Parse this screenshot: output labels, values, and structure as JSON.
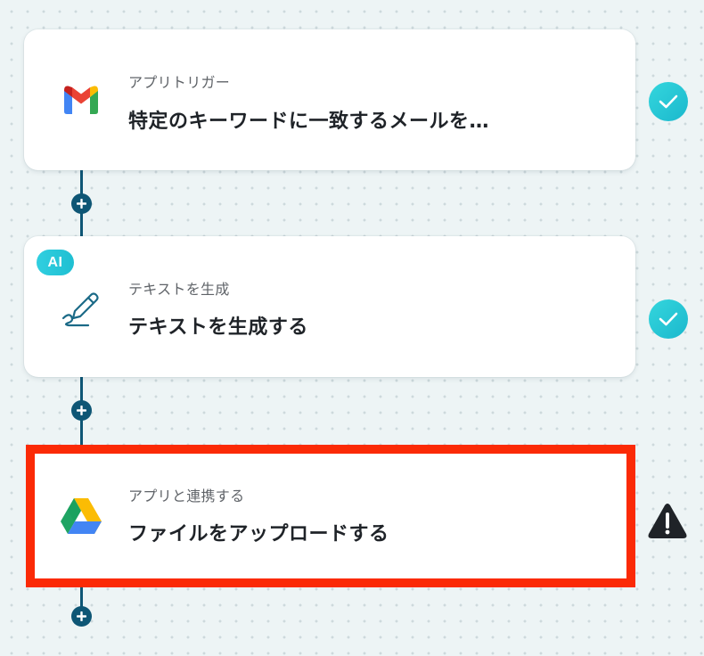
{
  "steps": [
    {
      "subtitle": "アプリトリガー",
      "title": "特定のキーワードに一致するメールを…",
      "app_icon": "gmail-icon",
      "status": "completed"
    },
    {
      "badge": "AI",
      "subtitle": "テキストを生成",
      "title": "テキストを生成する",
      "app_icon": "pen-icon",
      "status": "completed"
    },
    {
      "subtitle": "アプリと連携する",
      "title": "ファイルをアップロードする",
      "app_icon": "google-drive-icon",
      "status": "warning",
      "highlighted": true
    }
  ],
  "colors": {
    "connector": "#0e5675",
    "check": "#22c5d4",
    "highlight_border": "#fb2a06",
    "warning": "#1f2328"
  }
}
